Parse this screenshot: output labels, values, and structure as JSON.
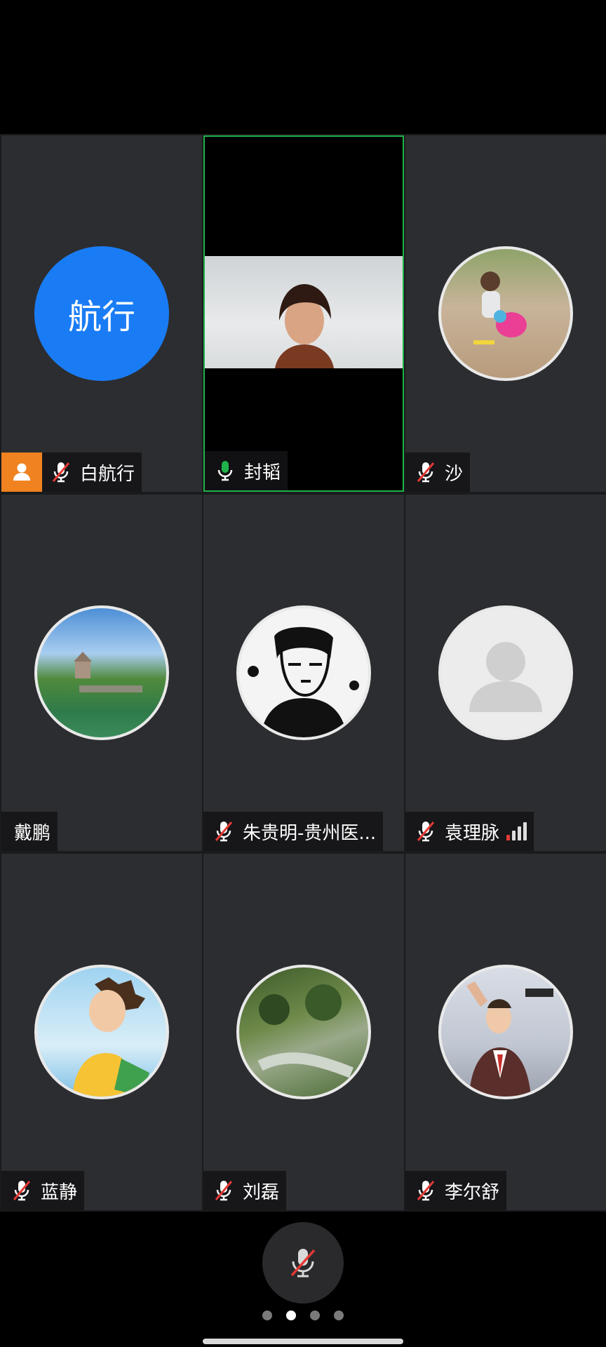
{
  "participants": [
    {
      "name": "白航行",
      "avatar_text": "航行",
      "avatar_color": "#1a7cf5",
      "mic": "muted",
      "host": true
    },
    {
      "name": "封韬",
      "mic": "active",
      "video": true
    },
    {
      "name": "沙",
      "mic": "muted",
      "avatar_icon": "child-photo"
    },
    {
      "name": "戴鹏",
      "mic": "none",
      "avatar_icon": "landscape-photo"
    },
    {
      "name": "朱贵明-贵州医...",
      "mic": "muted",
      "avatar_icon": "sketch-portrait"
    },
    {
      "name": "袁理脉",
      "mic": "muted",
      "avatar_icon": "default-person",
      "signal_level": 0.25
    },
    {
      "name": "蓝静",
      "mic": "muted",
      "avatar_icon": "cartoon-boy"
    },
    {
      "name": "刘磊",
      "mic": "muted",
      "avatar_icon": "forest-photo"
    },
    {
      "name": "李尔舒",
      "mic": "muted",
      "avatar_icon": "anime-illustration"
    }
  ],
  "controls": {
    "mute_button_icon": "mic-muted-icon"
  },
  "pager": {
    "pages": 4,
    "current_page": 2
  },
  "colors": {
    "active_border": "#1fb24a",
    "host_badge": "#f08220",
    "muted_slash": "#e53935",
    "signal_low": "#e53935"
  }
}
